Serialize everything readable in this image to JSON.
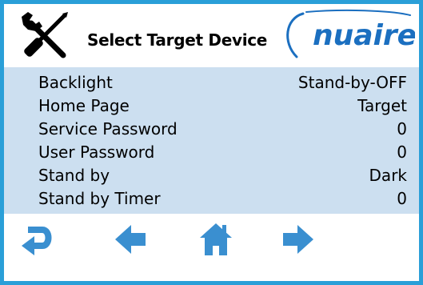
{
  "header": {
    "title": "Select Target Device",
    "tools_icon": "wrench-screwdriver-icon",
    "logo_text": "nuaire"
  },
  "settings": [
    {
      "label": "Backlight",
      "value": "Stand-by-OFF"
    },
    {
      "label": "Home Page",
      "value": "Target"
    },
    {
      "label": "Service Password",
      "value": "0"
    },
    {
      "label": "User Password",
      "value": "0"
    },
    {
      "label": "Stand by",
      "value": "Dark"
    },
    {
      "label": "Stand by Timer",
      "value": "0"
    }
  ],
  "nav": {
    "icons": [
      "return-icon",
      "left-arrow-icon",
      "home-icon",
      "right-arrow-icon"
    ]
  },
  "colors": {
    "frame": "#2a9fd8",
    "list_background": "#ccdff0",
    "icon": "#3a8fd0",
    "logo": "#1b6fc0"
  }
}
